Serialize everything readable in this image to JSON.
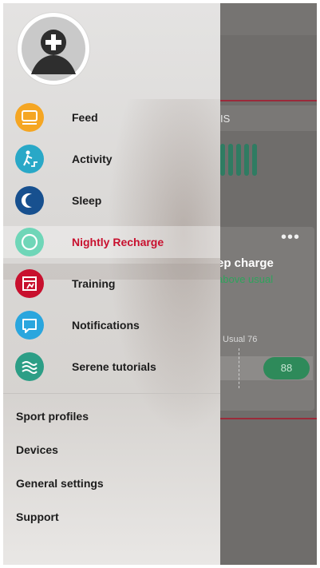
{
  "menu": {
    "items": [
      {
        "label": "Feed",
        "icon": "feed-icon",
        "color": "#f5a623",
        "active": false
      },
      {
        "label": "Activity",
        "icon": "activity-icon",
        "color": "#29a8c7",
        "active": false
      },
      {
        "label": "Sleep",
        "icon": "sleep-icon",
        "color": "#17508f",
        "active": false
      },
      {
        "label": "Nightly Recharge",
        "icon": "nightly-recharge-icon",
        "color": "#6fd6b8",
        "active": true
      },
      {
        "label": "Training",
        "icon": "training-icon",
        "color": "#c8102e",
        "active": false
      },
      {
        "label": "Notifications",
        "icon": "notifications-icon",
        "color": "#2aa6de",
        "active": false
      },
      {
        "label": "Serene tutorials",
        "icon": "serene-icon",
        "color": "#2c9e86",
        "active": false
      }
    ],
    "secondary": [
      "Sport profiles",
      "Devices",
      "General settings",
      "Support"
    ],
    "active_color": "#c8102e"
  },
  "background_app": {
    "tab_fragment": "IS",
    "card_title": "ep charge",
    "card_subtitle": "above usual",
    "usual_label": "Usual 76",
    "score": "88",
    "more": "•••",
    "accent": "#2e8a5a"
  }
}
